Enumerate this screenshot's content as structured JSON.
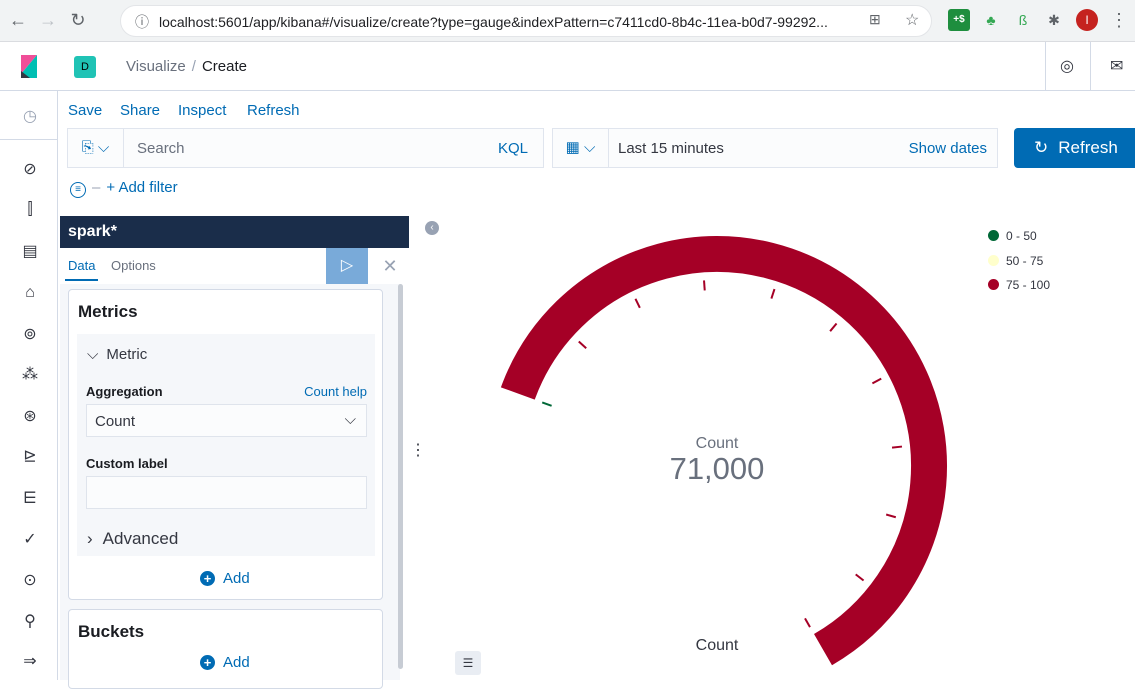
{
  "browser": {
    "url": "localhost:5601/app/kibana#/visualize/create?type=gauge&indexPattern=c7411cd0-8b4c-11ea-b0d7-99292...",
    "avatar_letter": "I"
  },
  "header": {
    "space_letter": "D",
    "breadcrumb_parent": "Visualize",
    "breadcrumb_sep": "/",
    "breadcrumb_current": "Create"
  },
  "top_menu": {
    "save": "Save",
    "share": "Share",
    "inspect": "Inspect",
    "refresh": "Refresh"
  },
  "query_bar": {
    "placeholder": "Search",
    "language": "KQL"
  },
  "date_picker": {
    "range": "Last 15 minutes",
    "show_dates": "Show dates"
  },
  "refresh_button": {
    "label": "Refresh"
  },
  "filter": {
    "add_label": "+ Add filter"
  },
  "sidebar": {
    "index_title": "spark*",
    "tab_data": "Data",
    "tab_options": "Options",
    "metrics_title": "Metrics",
    "metric_label": "Metric",
    "aggregation_label": "Aggregation",
    "count_help": "Count help",
    "aggregation_value": "Count",
    "custom_label": "Custom label",
    "advanced_label": "Advanced",
    "add_label": "Add",
    "buckets_title": "Buckets"
  },
  "gauge": {
    "metric_label": "Count",
    "value": "71,000",
    "footer_label": "Count",
    "fill_fraction": 0.71,
    "ranges": [
      {
        "label": "0 - 50",
        "color": "#006837"
      },
      {
        "label": "50 - 75",
        "color": "#ffffcc"
      },
      {
        "label": "75 - 100",
        "color": "#a50026"
      }
    ]
  }
}
